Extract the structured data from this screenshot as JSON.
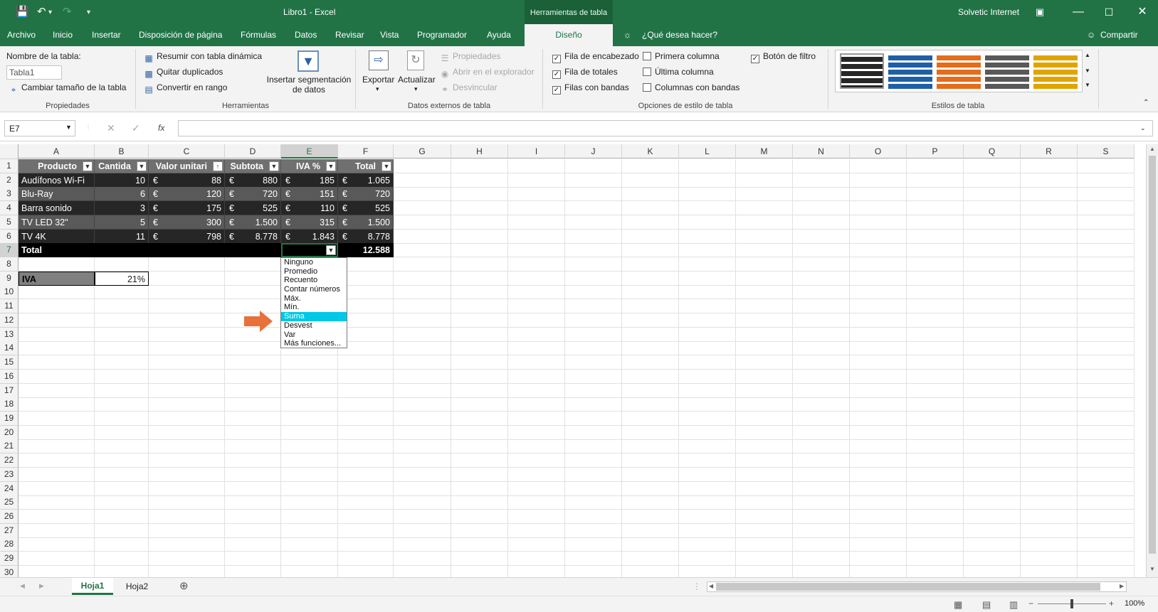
{
  "window": {
    "title": "Libro1  -  Excel",
    "context_tab": "Herramientas de tabla",
    "user": "Solvetic Internet"
  },
  "tabs": [
    "Archivo",
    "Inicio",
    "Insertar",
    "Disposición de página",
    "Fórmulas",
    "Datos",
    "Revisar",
    "Vista",
    "Programador",
    "Ayuda"
  ],
  "active_tab": "Diseño",
  "tell_me": "¿Qué desea hacer?",
  "share": "Compartir",
  "ribbon": {
    "props": {
      "name_label": "Nombre de la tabla:",
      "name_value": "Tabla1",
      "resize": "Cambiar tamaño de la tabla",
      "group": "Propiedades"
    },
    "tools": {
      "pivot": "Resumir con tabla dinámica",
      "dupes": "Quitar duplicados",
      "range": "Convertir en rango",
      "slicer1": "Insertar segmentación",
      "slicer2": "de datos",
      "group": "Herramientas"
    },
    "external": {
      "export": "Exportar",
      "refresh": "Actualizar",
      "props": "Propiedades",
      "open": "Abrir en el explorador",
      "unlink": "Desvincular",
      "group": "Datos externos de tabla"
    },
    "options": {
      "header": "Fila de encabezado",
      "totals": "Fila de totales",
      "banded_rows": "Filas con bandas",
      "first_col": "Primera columna",
      "last_col": "Última columna",
      "banded_cols": "Columnas con bandas",
      "filter_btn": "Botón de filtro",
      "group": "Opciones de estilo de tabla"
    },
    "styles": {
      "group": "Estilos de tabla",
      "colors": [
        "#262626",
        "#1f5fa8",
        "#e46c1a",
        "#595959",
        "#e0a400"
      ]
    }
  },
  "formula": {
    "namebox": "E7",
    "fx": "fx"
  },
  "columns": [
    "A",
    "B",
    "C",
    "D",
    "E",
    "F",
    "G",
    "H",
    "I",
    "J",
    "K",
    "L",
    "M",
    "N",
    "O",
    "P",
    "Q",
    "R",
    "S"
  ],
  "rows": [
    "1",
    "2",
    "3",
    "4",
    "5",
    "6",
    "7",
    "8",
    "9",
    "10",
    "11",
    "12",
    "13",
    "14",
    "15",
    "16",
    "17",
    "18",
    "19",
    "20",
    "21",
    "22",
    "23",
    "24",
    "25",
    "26",
    "27",
    "28",
    "29",
    "30"
  ],
  "table": {
    "headers": [
      "Producto",
      "Cantida",
      "Valor unitari",
      "Subtota",
      "IVA %",
      "Total"
    ],
    "currency": "€",
    "rows": [
      [
        "Audífonos Wi-Fi",
        "10",
        "88",
        "880",
        "185",
        "1.065"
      ],
      [
        "Blu-Ray",
        "6",
        "120",
        "720",
        "151",
        "720"
      ],
      [
        "Barra sonido",
        "3",
        "175",
        "525",
        "110",
        "525"
      ],
      [
        "TV LED 32\"",
        "5",
        "300",
        "1.500",
        "315",
        "1.500"
      ],
      [
        "TV 4K",
        "11",
        "798",
        "8.778",
        "1.843",
        "8.778"
      ]
    ],
    "total_label": "Total",
    "total_value": "12.588"
  },
  "iva": {
    "label": "IVA",
    "value": "21%"
  },
  "menu": [
    "Ninguno",
    "Promedio",
    "Recuento",
    "Contar números",
    "Máx.",
    "Mín.",
    "Suma",
    "Desvest",
    "Var",
    "Más funciones..."
  ],
  "menu_highlight": "Suma",
  "sheets": [
    "Hoja1",
    "Hoja2"
  ],
  "zoom": "100%"
}
